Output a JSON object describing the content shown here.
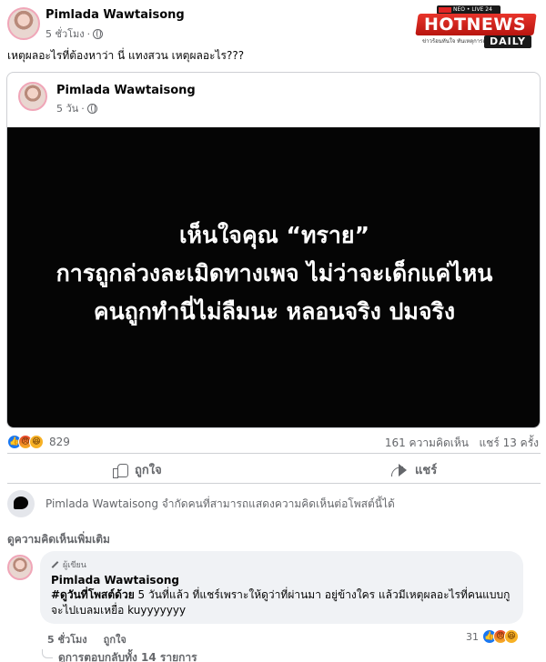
{
  "post": {
    "author": "Pimlada Wawtaisong",
    "time": "5 ชั่วโมง",
    "separator": "·",
    "privacy_icon": "globe-icon",
    "caption": "เหตุผลอะไรที่ต้องหาว่า นี่ แทงสวน เหตุผลอะไร???"
  },
  "logo": {
    "ribbon": "NEO • LIVE 24",
    "main": "HOTNEWS",
    "tagline": "ข่าวร้อนทันใจ ทันเหตุการณ์",
    "daily": "DAILY"
  },
  "shared_post": {
    "author": "Pimlada Wawtaisong",
    "time": "5 วัน",
    "separator": "·",
    "lines": [
      "เห็นใจคุณ “ทราย”",
      "การถูกล่วงละเมิดทางเพจ ไม่ว่าจะเด็กแค่ไหน",
      "คนถูกทำนี่ไม่ลืมนะ หลอนจริง ปมจริง"
    ]
  },
  "stats": {
    "reaction_count": "829",
    "comments_shares": "161 ความคิดเห็น   แชร์ 13 ครั้ง"
  },
  "actions": {
    "like_label": "ถูกใจ",
    "share_label": "แชร์"
  },
  "restriction_notice": "Pimlada Wawtaisong จำกัดคนที่สามารถแสดงความคิดเห็นต่อโพสต์นี้ได้",
  "more_comments": "ดูความคิดเห็นเพิ่มเติม",
  "comment": {
    "badge": "ผู้เขียน",
    "author": "Pimlada Wawtaisong",
    "hashtag": "#ดูวันที่โพสต์ด้วย",
    "text": " 5 วันที่แล้ว ที่แชร์เพราะให้ดูว่าที่ผ่านมา อยู่ข้างใคร แล้วมีเหตุผลอะไรที่คนแบบกูจะไปเบลมเหยื่อ kuyyyyyyy",
    "time": "5 ชั่วโมง",
    "like_label": "ถูกใจ",
    "reaction_count": "31"
  },
  "replies": "ดูการตอบกลับทั้ง 14 รายการ"
}
